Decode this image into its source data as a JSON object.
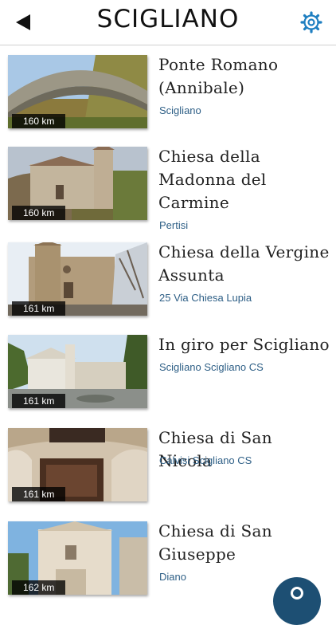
{
  "header": {
    "title": "SCIGLIANO",
    "back_icon": "back-arrow-icon",
    "settings_icon": "gear-icon",
    "accent_color": "#1f7fc1"
  },
  "places": [
    {
      "name": "Ponte Romano (Annibale)",
      "location": "Scigliano",
      "distance": "160 km"
    },
    {
      "name": "Chiesa della Madonna del Carmine",
      "location": "Pertisi",
      "distance": "160 km"
    },
    {
      "name": "Chiesa della Vergine Assunta",
      "location": "25 Via Chiesa Lupia",
      "distance": "161 km"
    },
    {
      "name": "In giro per Scigliano",
      "location": "Scigliano Scigliano CS",
      "distance": "161 km"
    },
    {
      "name": "Chiesa di San Nicola",
      "location": "Calvisi Scigliano CS",
      "distance": "161 km"
    },
    {
      "name": "Chiesa di San Giuseppe",
      "location": "Diano",
      "distance": "162 km"
    }
  ],
  "fab": {
    "icon": "location-pin-icon",
    "color": "#1d4f73"
  }
}
